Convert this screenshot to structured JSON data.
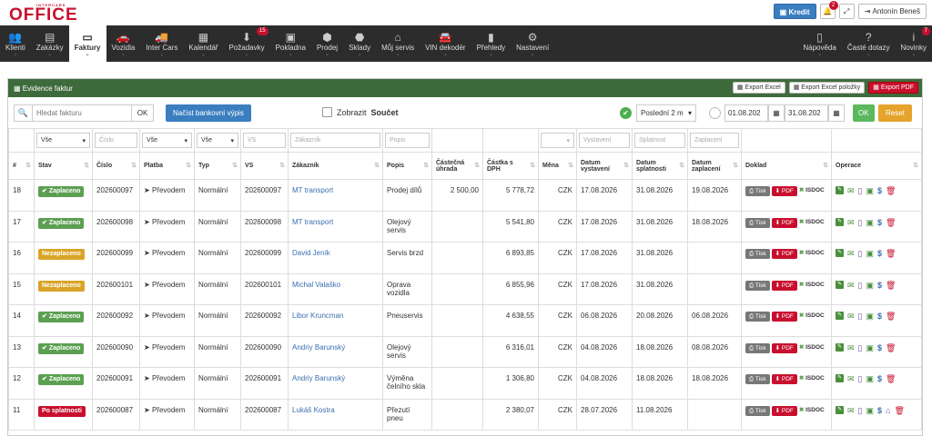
{
  "brand": {
    "small": "INTERCARS",
    "big": "OFFICE"
  },
  "top": {
    "kredit": "Kredit",
    "notif_count": "2",
    "user": "Antonín Beneš"
  },
  "nav": [
    {
      "label": "Klienti",
      "icon": "👥",
      "active": false
    },
    {
      "label": "Zakázky",
      "icon": "▤",
      "active": false
    },
    {
      "label": "Faktury",
      "icon": "▭",
      "active": true
    },
    {
      "label": "Vozidla",
      "icon": "🚗",
      "active": false
    },
    {
      "label": "Inter Cars",
      "icon": "🚚",
      "active": false
    },
    {
      "label": "Kalendář",
      "icon": "▦",
      "active": false
    },
    {
      "label": "Požadavky",
      "icon": "⬇",
      "active": false,
      "badge": "15"
    },
    {
      "label": "Pokladna",
      "icon": "▣",
      "active": false
    },
    {
      "label": "Prodej",
      "icon": "⬢",
      "active": false
    },
    {
      "label": "Sklady",
      "icon": "⬣",
      "active": false
    },
    {
      "label": "Můj servis",
      "icon": "⌂",
      "active": false
    },
    {
      "label": "VIN dekodér",
      "icon": "🚘",
      "active": false
    },
    {
      "label": "Přehledy",
      "icon": "▮",
      "active": false
    },
    {
      "label": "Nastavení",
      "icon": "⚙",
      "active": false
    }
  ],
  "nav_right": [
    {
      "label": "Nápověda",
      "icon": "▯"
    },
    {
      "label": "Časté dotazy",
      "icon": "?"
    },
    {
      "label": "Novinky",
      "icon": "i",
      "badge": "7"
    }
  ],
  "panel": {
    "title": "Evidence faktur",
    "export_excel": "Export Excel",
    "export_excel_items": "Export Excel položky",
    "export_pdf": "Export PDF"
  },
  "toolbar": {
    "search_placeholder": "Hledat fakturu",
    "ok": "OK",
    "bank": "Načíst bankovní výpis",
    "zobrazit": "Zobrazit",
    "soucet": "Součet",
    "period": "Poslední 2 m",
    "date_from": "01.08.202",
    "date_to": "31.08.202",
    "ok2": "OK",
    "reset": "Reset"
  },
  "filters": {
    "stav": "Vše",
    "cislo": "Číslo",
    "platba": "Vše",
    "typ": "Vše",
    "vs": "VS",
    "zakaznik": "Zákazník",
    "popis": "Popis",
    "vystaveni": "Vystavení",
    "splatnost": "Splatnost",
    "zaplaceni": "Zaplacení"
  },
  "headers": {
    "id": "#",
    "stav": "Stav",
    "cislo": "Číslo",
    "platba": "Platba",
    "typ": "Typ",
    "vs": "VS",
    "zakaznik": "Zákazník",
    "popis": "Popis",
    "castecna": "Částečná úhrada",
    "castka": "Částka s DPH",
    "mena": "Měna",
    "vystaveni": "Datum vystavení",
    "splatnost": "Datum splatnosti",
    "zaplaceni": "Datum zaplacení",
    "doklad": "Doklad",
    "operace": "Operace"
  },
  "doc": {
    "tisk": "Tisk",
    "pdf": "PDF",
    "isdoc": "ISDOC"
  },
  "rows": [
    {
      "id": "18",
      "stav": "Zaplaceno",
      "cls": "paid",
      "cislo": "202600097",
      "platba": "Převodem",
      "typ": "Normální",
      "vs": "202600097",
      "zakaznik": "MT transport",
      "popis": "Prodej dílů",
      "castecna": "2 500,00",
      "castka": "5 778,72",
      "mena": "CZK",
      "vystaveni": "17.08.2026",
      "splatnost": "31.08.2026",
      "zaplaceni": "19.08.2026",
      "bank": false
    },
    {
      "id": "17",
      "stav": "Zaplaceno",
      "cls": "paid",
      "cislo": "202600098",
      "platba": "Převodem",
      "typ": "Normální",
      "vs": "202600098",
      "zakaznik": "MT transport",
      "popis": "Olejový servis",
      "castecna": "",
      "castka": "5 541,80",
      "mena": "CZK",
      "vystaveni": "17.08.2026",
      "splatnost": "31.08.2026",
      "zaplaceni": "18.08.2026",
      "bank": false
    },
    {
      "id": "16",
      "stav": "Nezaplaceno",
      "cls": "unpaid",
      "cislo": "202600099",
      "platba": "Převodem",
      "typ": "Normální",
      "vs": "202600099",
      "zakaznik": "David Jeník",
      "popis": "Servis brzd",
      "castecna": "",
      "castka": "6 893,85",
      "mena": "CZK",
      "vystaveni": "17.08.2026",
      "splatnost": "31.08.2026",
      "zaplaceni": "",
      "bank": false
    },
    {
      "id": "15",
      "stav": "Nezaplaceno",
      "cls": "unpaid",
      "cislo": "202600101",
      "platba": "Převodem",
      "typ": "Normální",
      "vs": "202600101",
      "zakaznik": "Michal Valaško",
      "popis": "Oprava vozidla",
      "castecna": "",
      "castka": "6 855,96",
      "mena": "CZK",
      "vystaveni": "17.08.2026",
      "splatnost": "31.08.2026",
      "zaplaceni": "",
      "bank": false
    },
    {
      "id": "14",
      "stav": "Zaplaceno",
      "cls": "paid",
      "cislo": "202600092",
      "platba": "Převodem",
      "typ": "Normální",
      "vs": "202600092",
      "zakaznik": "Libor Kruncman",
      "popis": "Pneuservis",
      "castecna": "",
      "castka": "4 638,55",
      "mena": "CZK",
      "vystaveni": "06.08.2026",
      "splatnost": "20.08.2026",
      "zaplaceni": "06.08.2026",
      "bank": false
    },
    {
      "id": "13",
      "stav": "Zaplaceno",
      "cls": "paid",
      "cislo": "202600090",
      "platba": "Převodem",
      "typ": "Normální",
      "vs": "202600090",
      "zakaznik": "Andriy Barunský",
      "popis": "Olejový servis",
      "castecna": "",
      "castka": "6 316,01",
      "mena": "CZK",
      "vystaveni": "04.08.2026",
      "splatnost": "18.08.2026",
      "zaplaceni": "08.08.2026",
      "bank": false
    },
    {
      "id": "12",
      "stav": "Zaplaceno",
      "cls": "paid",
      "cislo": "202600091",
      "platba": "Převodem",
      "typ": "Normální",
      "vs": "202600091",
      "zakaznik": "Andriy Barunský",
      "popis": "Výměna čelního skla",
      "castecna": "",
      "castka": "1 306,80",
      "mena": "CZK",
      "vystaveni": "04.08.2026",
      "splatnost": "18.08.2026",
      "zaplaceni": "18.08.2026",
      "bank": false
    },
    {
      "id": "11",
      "stav": "Po splatnosti",
      "cls": "due",
      "cislo": "202600087",
      "platba": "Převodem",
      "typ": "Normální",
      "vs": "202600087",
      "zakaznik": "Lukáš Kostra",
      "popis": "Přezutí pneu",
      "castecna": "",
      "castka": "2 380,07",
      "mena": "CZK",
      "vystaveni": "28.07.2026",
      "splatnost": "11.08.2026",
      "zaplaceni": "",
      "bank": true
    }
  ]
}
